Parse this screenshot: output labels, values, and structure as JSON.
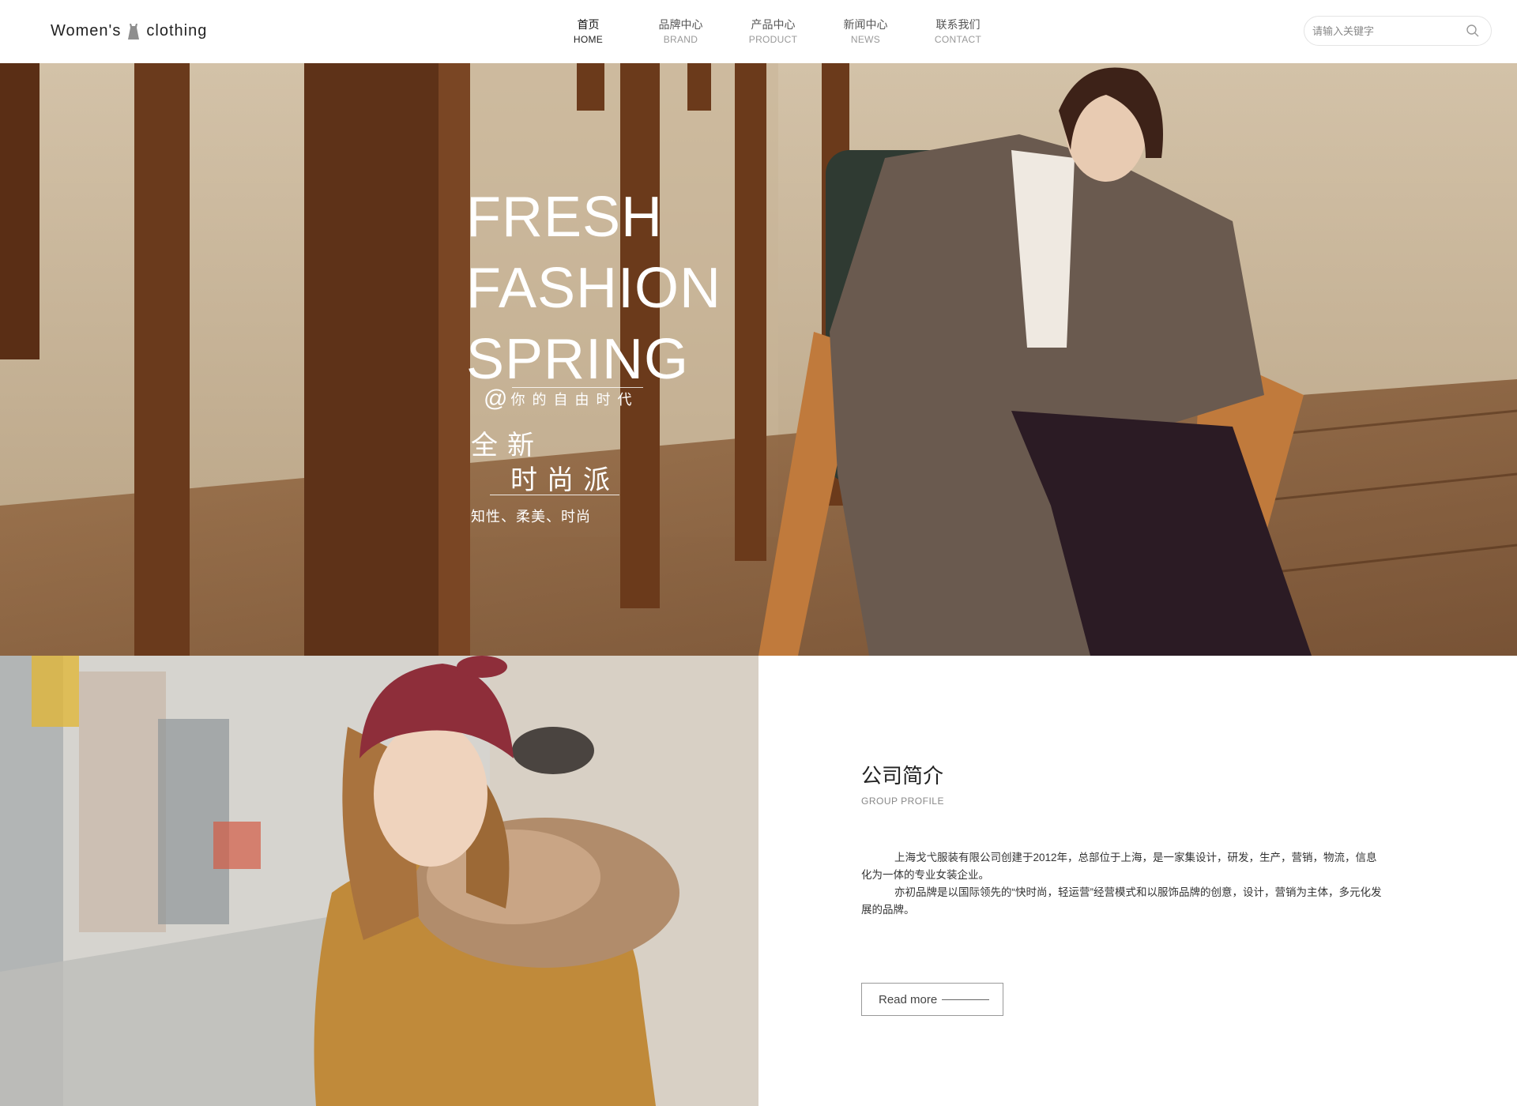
{
  "header": {
    "logo_left": "Women's",
    "logo_right": "clothing",
    "logo_icon": "dress-icon",
    "nav": [
      {
        "cn": "首页",
        "en": "HOME",
        "active": true
      },
      {
        "cn": "品牌中心",
        "en": "BRAND",
        "active": false
      },
      {
        "cn": "产品中心",
        "en": "PRODUCT",
        "active": false
      },
      {
        "cn": "新闻中心",
        "en": "NEWS",
        "active": false
      },
      {
        "cn": "联系我们",
        "en": "CONTACT",
        "active": false
      }
    ],
    "search": {
      "placeholder": "请输入关键字",
      "value": "",
      "icon": "search-icon"
    }
  },
  "hero": {
    "lines": [
      "FRESH",
      "FASHION",
      "SPRING"
    ],
    "sub": "你的自由时代",
    "at": "@",
    "cn_line1": "全新",
    "cn_line2": "时尚派",
    "tagline": "知性、柔美、时尚"
  },
  "profile": {
    "title": "公司简介",
    "subtitle": "GROUP PROFILE",
    "paragraphs": [
      "上海戈弋服装有限公司创建于2012年，总部位于上海，是一家集设计，研发，生产，营销，物流，信息化为一体的专业女装企业。",
      "亦初品牌是以国际领先的“快时尚，轻运营”经营模式和以服饰品牌的创意，设计，营销为主体，多元化发展的品牌。"
    ],
    "read_more": "Read more"
  },
  "colors": {
    "accent": "#111111",
    "muted": "#999999",
    "hero_text": "#ffffff"
  }
}
